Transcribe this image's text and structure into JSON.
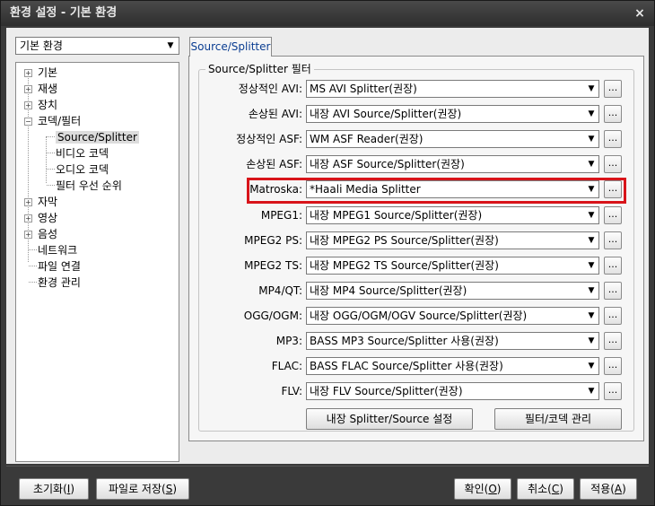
{
  "window": {
    "title": "환경 설정 - 기본 환경",
    "close_glyph": "×"
  },
  "category_select": {
    "value": "기본 환경",
    "arrow": "▼"
  },
  "tree": {
    "items": [
      {
        "label": "기본",
        "expander": "+"
      },
      {
        "label": "재생",
        "expander": "+"
      },
      {
        "label": "장치",
        "expander": "+"
      },
      {
        "label": "코덱/필터",
        "expander": "−"
      },
      {
        "label": "Source/Splitter",
        "expander": ""
      },
      {
        "label": "비디오 코덱",
        "expander": ""
      },
      {
        "label": "오디오 코덱",
        "expander": ""
      },
      {
        "label": "필터 우선 순위",
        "expander": ""
      },
      {
        "label": "자막",
        "expander": "+"
      },
      {
        "label": "영상",
        "expander": "+"
      },
      {
        "label": "음성",
        "expander": "+"
      },
      {
        "label": "네트워크",
        "expander": ""
      },
      {
        "label": "파일 연결",
        "expander": ""
      },
      {
        "label": "환경 관리",
        "expander": ""
      }
    ]
  },
  "tab": {
    "label": "Source/Splitter"
  },
  "group": {
    "title": "Source/Splitter 필터"
  },
  "filters": [
    {
      "label": "정상적인 AVI:",
      "value": "MS AVI Splitter(권장)"
    },
    {
      "label": "손상된 AVI:",
      "value": "내장 AVI Source/Splitter(권장)"
    },
    {
      "label": "정상적인 ASF:",
      "value": "WM ASF Reader(권장)"
    },
    {
      "label": "손상된 ASF:",
      "value": "내장 ASF Source/Splitter(권장)"
    },
    {
      "label": "Matroska:",
      "value": "*Haali Media Splitter"
    },
    {
      "label": "MPEG1:",
      "value": "내장 MPEG1 Source/Splitter(권장)"
    },
    {
      "label": "MPEG2 PS:",
      "value": "내장 MPEG2 PS Source/Splitter(권장)"
    },
    {
      "label": "MPEG2 TS:",
      "value": "내장 MPEG2 TS Source/Splitter(권장)"
    },
    {
      "label": "MP4/QT:",
      "value": "내장 MP4 Source/Splitter(권장)"
    },
    {
      "label": "OGG/OGM:",
      "value": "내장 OGG/OGM/OGV Source/Splitter(권장)"
    },
    {
      "label": "MP3:",
      "value": "BASS MP3 Source/Splitter 사용(권장)"
    },
    {
      "label": "FLAC:",
      "value": "BASS FLAC Source/Splitter 사용(권장)"
    },
    {
      "label": "FLV:",
      "value": "내장 FLV Source/Splitter(권장)"
    }
  ],
  "more_button_label": "...",
  "dropdown_arrow": "▼",
  "panel_buttons": {
    "builtin_settings": "내장 Splitter/Source 설정",
    "filter_codec_manage": "필터/코덱 관리"
  },
  "footer": {
    "reset": {
      "text": "초기화(",
      "key": "I",
      "close": ")"
    },
    "save_file": {
      "text": "파일로 저장(",
      "key": "S",
      "close": ")"
    },
    "ok": {
      "text": "확인(",
      "key": "O",
      "close": ")"
    },
    "cancel": {
      "text": "취소(",
      "key": "C",
      "close": ")"
    },
    "apply": {
      "text": "적용(",
      "key": "A",
      "close": ")"
    }
  },
  "colors": {
    "highlight": "#d8141a",
    "tab_text": "#0a3d91",
    "window_frame": "#3a3a3a"
  }
}
